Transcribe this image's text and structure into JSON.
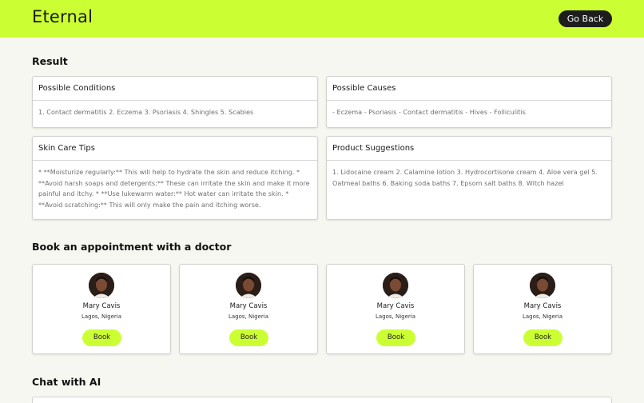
{
  "header": {
    "brand": "Eternal",
    "go_back_label": "Go Back",
    "accent_color": "#ccff33"
  },
  "result": {
    "title": "Result",
    "cards": [
      {
        "title": "Possible Conditions",
        "body": "1. Contact dermatitis 2. Eczema 3. Psoriasis 4. Shingles 5. Scabies"
      },
      {
        "title": "Possible Causes",
        "body": "- Eczema - Psoriasis - Contact dermatitis - Hives - Folliculitis"
      },
      {
        "title": "Skin Care Tips",
        "body": "* **Moisturize regularly:** This will help to hydrate the skin and reduce itching. * **Avoid harsh soaps and detergents:** These can irritate the skin and make it more painful and itchy. * **Use lukewarm water:** Hot water can irritate the skin. * **Avoid scratching:** This will only make the pain and itching worse."
      },
      {
        "title": "Product Suggestions",
        "body": "1. Lidocaine cream 2. Calamine lotion 3. Hydrocortisone cream 4. Aloe vera gel 5. Oatmeal baths 6. Baking soda baths 7. Epsom salt baths 8. Witch hazel"
      }
    ]
  },
  "appointments": {
    "title": "Book an appointment with a doctor",
    "doctors": [
      {
        "name": "Mary Cavis",
        "location": "Lagos, Nigeria",
        "book_label": "Book"
      },
      {
        "name": "Mary Cavis",
        "location": "Lagos, Nigeria",
        "book_label": "Book"
      },
      {
        "name": "Mary Cavis",
        "location": "Lagos, Nigeria",
        "book_label": "Book"
      },
      {
        "name": "Mary Cavis",
        "location": "Lagos, Nigeria",
        "book_label": "Book"
      }
    ]
  },
  "chat": {
    "title": "Chat with AI"
  }
}
